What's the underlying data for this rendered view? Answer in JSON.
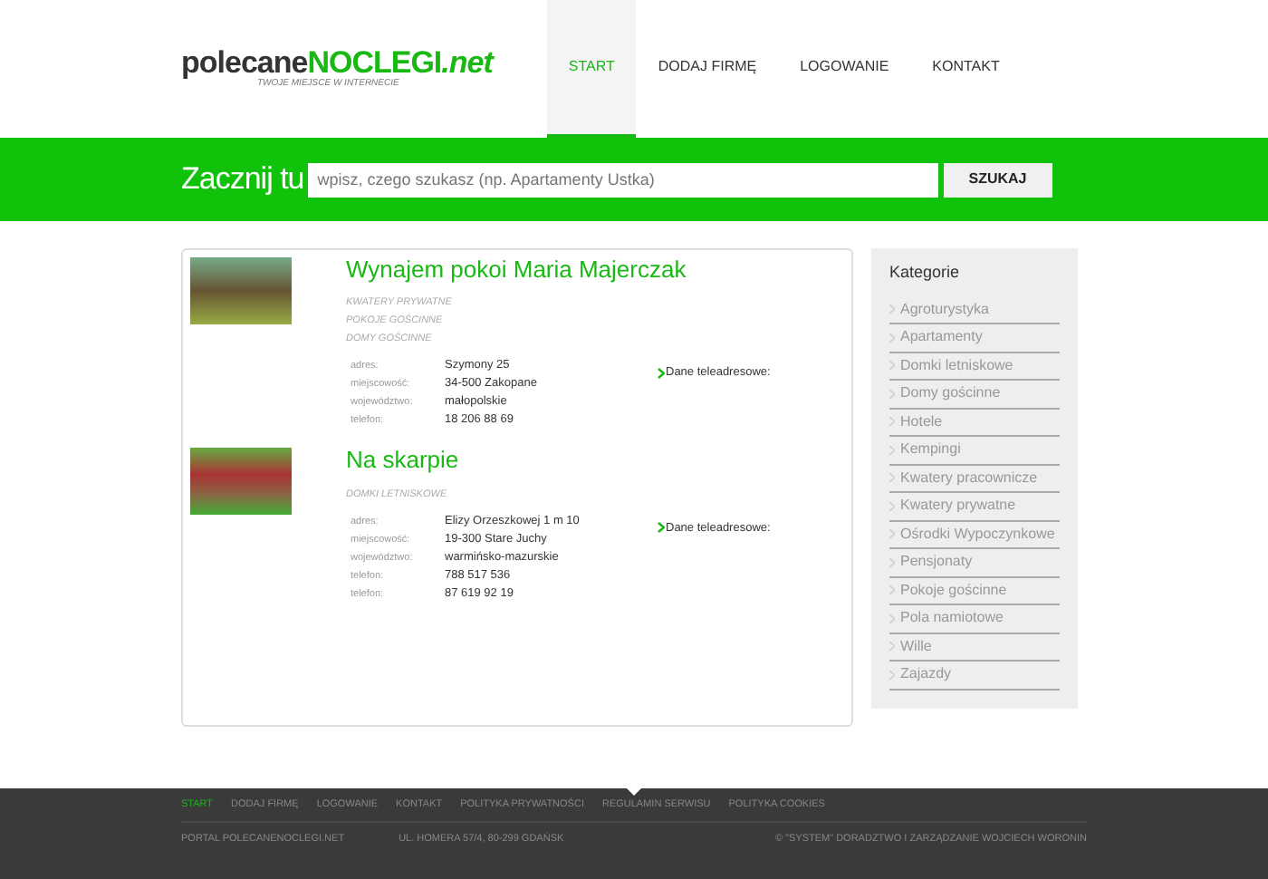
{
  "logo": {
    "prefix": "polecane",
    "main": "NOCLEGI",
    "suffix": ".net",
    "tagline": "TWOJE MIEJSCE W INTERNECIE"
  },
  "nav": [
    {
      "label": "START",
      "selected": true
    },
    {
      "label": "DODAJ FIRMĘ",
      "selected": false
    },
    {
      "label": "LOGOWANIE",
      "selected": false
    },
    {
      "label": "KONTAKT",
      "selected": false
    }
  ],
  "search": {
    "heading": "Zacznij tu",
    "placeholder": "wpisz, czego szukasz (np. Apartamenty Ustka)",
    "button": "SZUKAJ"
  },
  "listings": [
    {
      "title": "Wynajem pokoi Maria Majerczak",
      "categories": [
        "KWATERY PRYWATNE",
        "POKOJE GOŚCINNE",
        "DOMY GOŚCINNE"
      ],
      "fields": [
        {
          "label": "adres:",
          "value": "Szymony 25"
        },
        {
          "label": "miejscowość:",
          "value": "34-500 Zakopane"
        },
        {
          "label": "województwo:",
          "value": "małopolskie"
        },
        {
          "label": "telefon:",
          "value": "18 206 88 69"
        }
      ],
      "contact_link": "Dane teleadresowe:"
    },
    {
      "title": "Na skarpie",
      "categories": [
        "DOMKI LETNISKOWE"
      ],
      "fields": [
        {
          "label": "adres:",
          "value": "Elizy Orzeszkowej 1 m 10"
        },
        {
          "label": "miejscowość:",
          "value": "19-300 Stare Juchy"
        },
        {
          "label": "województwo:",
          "value": "warmińsko-mazurskie"
        },
        {
          "label": "telefon:",
          "value": "788 517 536"
        },
        {
          "label": "telefon:",
          "value": "87 619 92 19"
        }
      ],
      "contact_link": "Dane teleadresowe:"
    }
  ],
  "sidebar": {
    "title": "Kategorie",
    "items": [
      "Agroturystyka",
      "Apartamenty",
      "Domki letniskowe",
      "Domy gościnne",
      "Hotele",
      "Kempingi",
      "Kwatery pracownicze",
      "Kwatery prywatne",
      "Ośrodki Wypoczynkowe",
      "Pensjonaty",
      "Pokoje gościnne",
      "Pola namiotowe",
      "Wille",
      "Zajazdy"
    ]
  },
  "footer": {
    "links": [
      {
        "label": "START",
        "selected": true
      },
      {
        "label": "DODAJ FIRMĘ",
        "selected": false
      },
      {
        "label": "LOGOWANIE",
        "selected": false
      },
      {
        "label": "KONTAKT",
        "selected": false
      },
      {
        "label": "POLITYKA PRYWATNOŚCI",
        "selected": false
      },
      {
        "label": "REGULAMIN SERWISU",
        "selected": false
      },
      {
        "label": "POLITYKA COOKIES",
        "selected": false
      }
    ],
    "portal": "PORTAL POLECANENOCLEGI.NET",
    "address": "UL. HOMERA 57/4, 80-299 GDAŃSK",
    "copyright": "© \"SYSTEM\" DORADZTWO I ZARZĄDZANIE WOJCIECH WORONIN"
  }
}
